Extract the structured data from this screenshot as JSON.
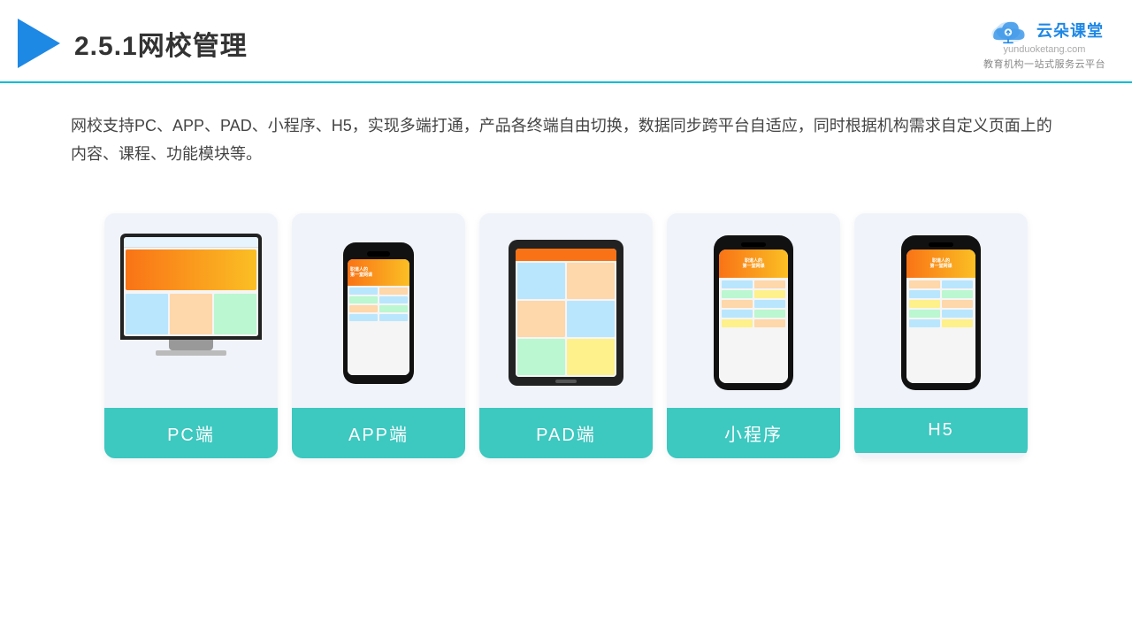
{
  "header": {
    "title": "2.5.1网校管理",
    "logo_main": "云朵课堂",
    "logo_url": "yunduoketang.com",
    "logo_sub": "教育机构一站式服务云平台"
  },
  "description": {
    "text": "网校支持PC、APP、PAD、小程序、H5，实现多端打通，产品各终端自由切换，数据同步跨平台自适应，同时根据机构需求自定义页面上的内容、课程、功能模块等。"
  },
  "cards": [
    {
      "id": "pc",
      "label": "PC端"
    },
    {
      "id": "app",
      "label": "APP端"
    },
    {
      "id": "pad",
      "label": "PAD端"
    },
    {
      "id": "miniapp",
      "label": "小程序"
    },
    {
      "id": "h5",
      "label": "H5"
    }
  ]
}
